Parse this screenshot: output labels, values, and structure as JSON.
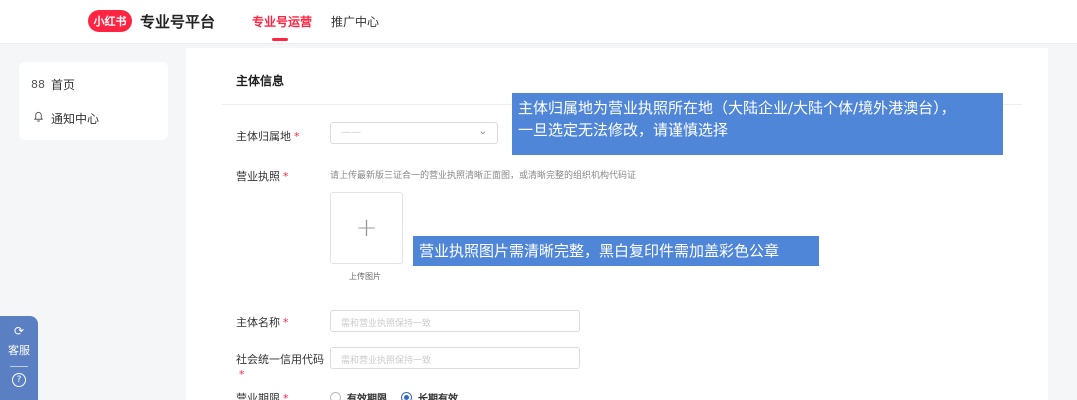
{
  "header": {
    "logo_text": "小红书",
    "platform_title": "专业号平台",
    "tabs": [
      {
        "label": "专业号运营",
        "active": true
      },
      {
        "label": "推广中心",
        "active": false
      }
    ],
    "brand_color": "#ff2442"
  },
  "sidebar": {
    "items": [
      {
        "label": "首页",
        "icon": "grid-icon"
      },
      {
        "label": "通知中心",
        "icon": "bell-icon"
      }
    ]
  },
  "floating": {
    "service_label": "客服"
  },
  "form": {
    "section_title": "主体信息",
    "fields": {
      "entity_region": {
        "label": "主体归属地",
        "required": "*"
      },
      "license": {
        "label": "营业执照",
        "required": "*",
        "hint": "请上传最新版三证合一的营业执照清晰正面图，或清晰完整的组织机构代码证",
        "upload_label": "上传图片"
      },
      "entity_name": {
        "label": "主体名称",
        "required": "*",
        "placeholder": "需和营业执照保持一致"
      },
      "credit_code": {
        "label": "社会统一信用代码",
        "required": "*",
        "placeholder": "需和营业执照保持一致"
      },
      "validity": {
        "label": "营业期限",
        "required": "*",
        "options": [
          {
            "label": "有效期限",
            "selected": false
          },
          {
            "label": "长期有效",
            "selected": true
          }
        ]
      }
    }
  },
  "callouts": {
    "region_note_line1": "主体归属地为营业执照所在地（大陆企业/大陆个体/境外港澳台），",
    "region_note_line2": "一旦选定无法修改，请谨慎选择",
    "license_note": "营业执照图片需清晰完整，黑白复印件需加盖彩色公章"
  },
  "accent_color": "#4f86d8"
}
